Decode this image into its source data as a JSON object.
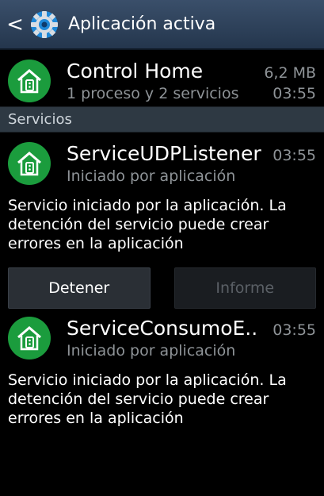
{
  "header": {
    "title": "Aplicación activa",
    "back_glyph": "<",
    "icon": "settings-gear-icon"
  },
  "app": {
    "name": "Control Home",
    "size": "6,2 MB",
    "processes": "1 proceso y 2 servicios",
    "time": "03:55",
    "icon": "home-remote-icon",
    "icon_color": "#1b9c3d"
  },
  "section_label": "Servicios",
  "services": [
    {
      "name": "ServiceUDPListener",
      "time": "03:55",
      "status": "Iniciado por aplicación",
      "description": "Servicio iniciado por la aplicación. La detención del servicio puede crear errores en la aplicación",
      "buttons": {
        "stop": "Detener",
        "report": "Informe"
      }
    },
    {
      "name": "ServiceConsumoE..",
      "time": "03:55",
      "status": "Iniciado por aplicación",
      "description": "Servicio iniciado por la aplicación. La detención del servicio puede crear errores en la aplicación"
    }
  ],
  "colors": {
    "titlebar": "#2d4460",
    "section": "#2e3943",
    "muted_text": "#8e9397",
    "report_disabled": "#5b6066"
  }
}
